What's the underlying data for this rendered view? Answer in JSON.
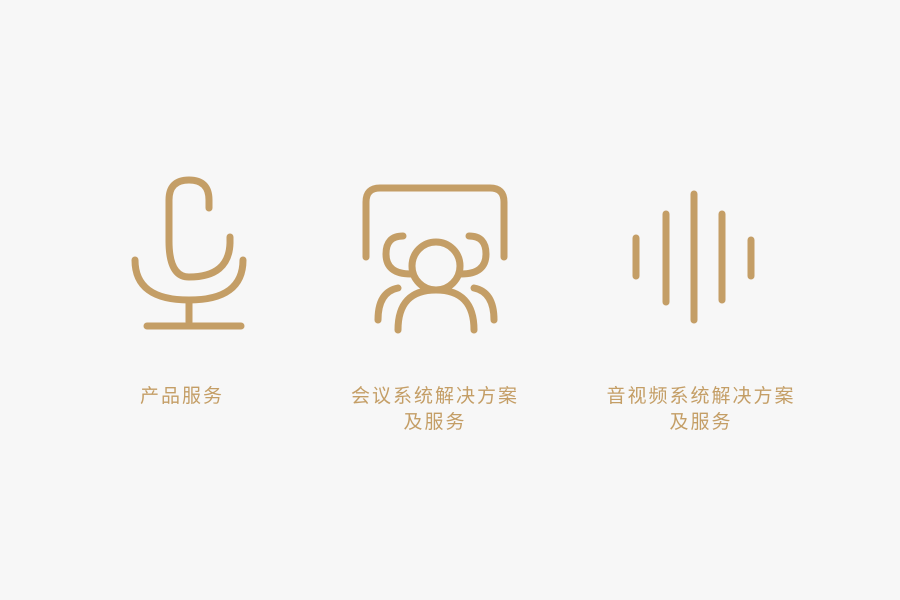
{
  "accent_color": "#c49e66",
  "background_color": "#f7f7f7",
  "services": [
    {
      "icon": "microphone-icon",
      "label_lines": [
        "产品服务"
      ]
    },
    {
      "icon": "meeting-group-icon",
      "label_lines": [
        "会议系统解决方案",
        "及服务"
      ]
    },
    {
      "icon": "sound-wave-icon",
      "label_lines": [
        "音视频系统解决方案",
        "及服务"
      ]
    }
  ]
}
